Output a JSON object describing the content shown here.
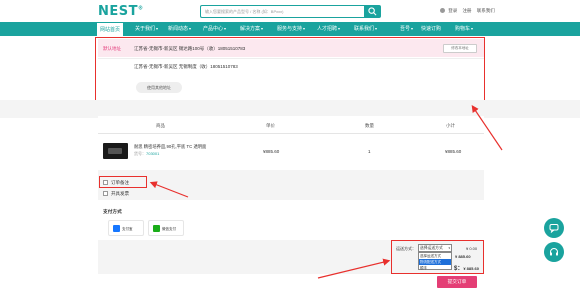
{
  "header": {
    "logo": "NEST",
    "logo_mark": "®",
    "search_placeholder": "输入您要搜索的产品型号 / 名称 (如：BPxxx)",
    "links": [
      "登录",
      "注册",
      "联系我们"
    ]
  },
  "nav": {
    "items": [
      {
        "label": "网站首页",
        "active": true
      },
      {
        "label": "关于我们",
        "caret": true
      },
      {
        "label": "新闻动态",
        "caret": true
      },
      {
        "label": "产品中心",
        "caret": true
      },
      {
        "label": "解决方案",
        "caret": true
      },
      {
        "label": "服务与支持",
        "caret": true
      },
      {
        "label": "人才招聘",
        "caret": true
      },
      {
        "label": "联系我们",
        "caret": true
      },
      {
        "label": "吾号",
        "caret": true
      },
      {
        "label": "快速订购"
      },
      {
        "label": "购物车",
        "caret": true
      }
    ]
  },
  "address": {
    "tag": "默认地址",
    "line1": "江苏省-无锡市-新吴区 锡达路100号（收）18051510783",
    "edit_label": "修改本地址",
    "line2": "江苏省-无锡市-新吴区 无锡制度（收）18051510783",
    "new_button": "使用其他地址"
  },
  "order": {
    "headers": [
      "商品",
      "单价",
      "数量",
      "小计"
    ],
    "product": {
      "name": "耐思 精密培养皿,90孔,平底 TC 透明面",
      "sub_label": "货号：",
      "sku": "703001",
      "price": "¥885.60",
      "qty": "1",
      "subtotal": "¥885.60"
    },
    "note_label": "订单备注",
    "invoice_label": "开具发票"
  },
  "payment": {
    "title": "支付方式",
    "methods": [
      {
        "label": "支付宝",
        "icon": "alipay-icon",
        "color": "#1677ff"
      },
      {
        "label": "微信支付",
        "icon": "wechat-pay-icon",
        "color": "#1aad19"
      }
    ]
  },
  "shipping": {
    "label": "运送方式：",
    "selected": "选择运送方式",
    "options": [
      "选择运送方式",
      "物流配送方式",
      "顺丰"
    ],
    "fee": "¥ 0.00",
    "goods_total": "¥ 885.60",
    "total_label": "$：",
    "total": "¥ 885.60"
  },
  "submit_label": "提交订单",
  "colors": {
    "brand": "#1aa39e",
    "accent": "#e43e75",
    "highlight": "#e8302d"
  }
}
